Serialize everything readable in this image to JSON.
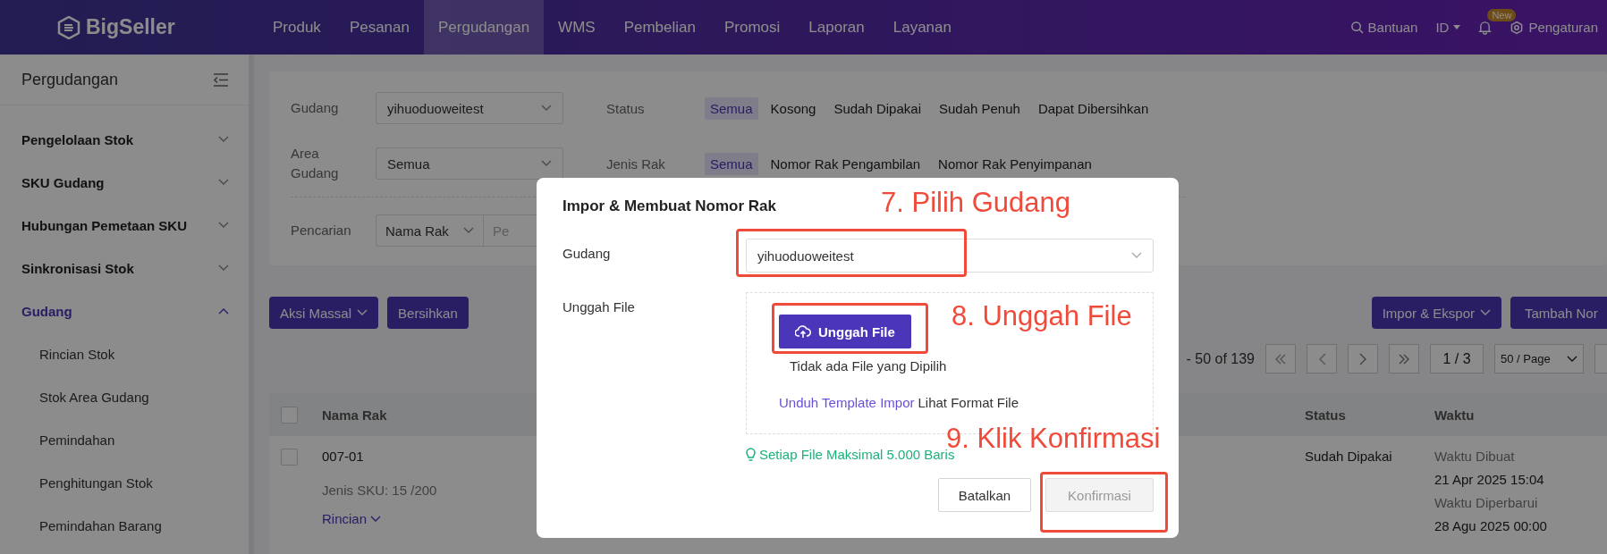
{
  "top_nav": {
    "logo": "BigSeller",
    "items": [
      {
        "label": "Produk",
        "selected": false
      },
      {
        "label": "Pesanan",
        "selected": false
      },
      {
        "label": "Pergudangan",
        "selected": true
      },
      {
        "label": "WMS",
        "selected": false
      },
      {
        "label": "Pembelian",
        "selected": false
      },
      {
        "label": "Promosi",
        "selected": false
      },
      {
        "label": "Laporan",
        "selected": false
      },
      {
        "label": "Layanan",
        "selected": false
      }
    ],
    "help": "Bantuan",
    "language": "ID",
    "badge": "New",
    "settings": "Pengaturan"
  },
  "sidebar": {
    "title": "Pergudangan",
    "groups": [
      {
        "label": "Pengelolaan Stok",
        "expanded": false,
        "selected": false
      },
      {
        "label": "SKU Gudang",
        "expanded": false,
        "selected": false
      },
      {
        "label": "Hubungan Pemetaan SKU",
        "expanded": false,
        "selected": false
      },
      {
        "label": "Sinkronisasi Stok",
        "expanded": false,
        "selected": false
      },
      {
        "label": "Gudang",
        "expanded": true,
        "selected": true,
        "children": [
          {
            "label": "Rincian Stok"
          },
          {
            "label": "Stok Area Gudang"
          },
          {
            "label": "Pemindahan"
          },
          {
            "label": "Penghitungan Stok"
          },
          {
            "label": "Pemindahan Barang"
          }
        ]
      }
    ]
  },
  "filters": {
    "warehouse": {
      "label": "Gudang",
      "value": "yihuoduoweitest"
    },
    "status": {
      "label": "Status",
      "options": [
        {
          "label": "Semua",
          "selected": true
        },
        {
          "label": "Kosong",
          "selected": false
        },
        {
          "label": "Sudah Dipakai",
          "selected": false
        },
        {
          "label": "Sudah Penuh",
          "selected": false
        },
        {
          "label": "Dapat Dibersihkan",
          "selected": false
        }
      ]
    },
    "area": {
      "label": "Area Gudang",
      "value": "Semua"
    },
    "rack_type": {
      "label": "Jenis Rak",
      "options": [
        {
          "label": "Semua",
          "selected": true
        },
        {
          "label": "Nomor Rak Pengambilan",
          "selected": false
        },
        {
          "label": "Nomor Rak Penyimpanan",
          "selected": false
        }
      ]
    },
    "search": {
      "label": "Pencarian",
      "field": "Nama Rak",
      "placeholder": "Pe"
    }
  },
  "toolbar": {
    "left": [
      "Aksi Massal",
      "Bersihkan"
    ],
    "right": [
      "Impor & Ekspor",
      "Tambah Nor"
    ]
  },
  "pagination": {
    "range": "- 50 of 139",
    "page": "1 / 3",
    "page_size": "50 / Page"
  },
  "table": {
    "header_checked": false,
    "columns": [
      "Nama Rak",
      "Status",
      "Waktu"
    ],
    "rows": [
      {
        "checked": false,
        "name": "007-01",
        "sku": "Jenis SKU: 15 /200",
        "details": "Rincian",
        "status": "Sudah Dipakai",
        "created_label": "Waktu Dibuat",
        "created": "21 Apr 2025 15:04",
        "updated_label": "Waktu Diperbarui",
        "updated": "28 Agu 2025 00:00"
      }
    ]
  },
  "dialog": {
    "title": "Impor & Membuat Nomor Rak",
    "warehouse_label": "Gudang",
    "warehouse_value": "yihuoduoweitest",
    "upload_label": "Unggah File",
    "upload_button": "Unggah File",
    "no_file": "Tidak ada File yang Dipilih",
    "template_link": "Unduh Template Impor",
    "format_text": "Lihat Format File",
    "hint": "Setiap File Maksimal 5.000 Baris",
    "buttons": [
      {
        "label": "Batalkan",
        "kind": "cancel",
        "disabled": false
      },
      {
        "label": "Konfirmasi",
        "kind": "confirm",
        "disabled": true
      }
    ]
  },
  "annotations": [
    "7. Pilih Gudang",
    "8. Unggah File",
    "9. Klik Konfirmasi"
  ]
}
